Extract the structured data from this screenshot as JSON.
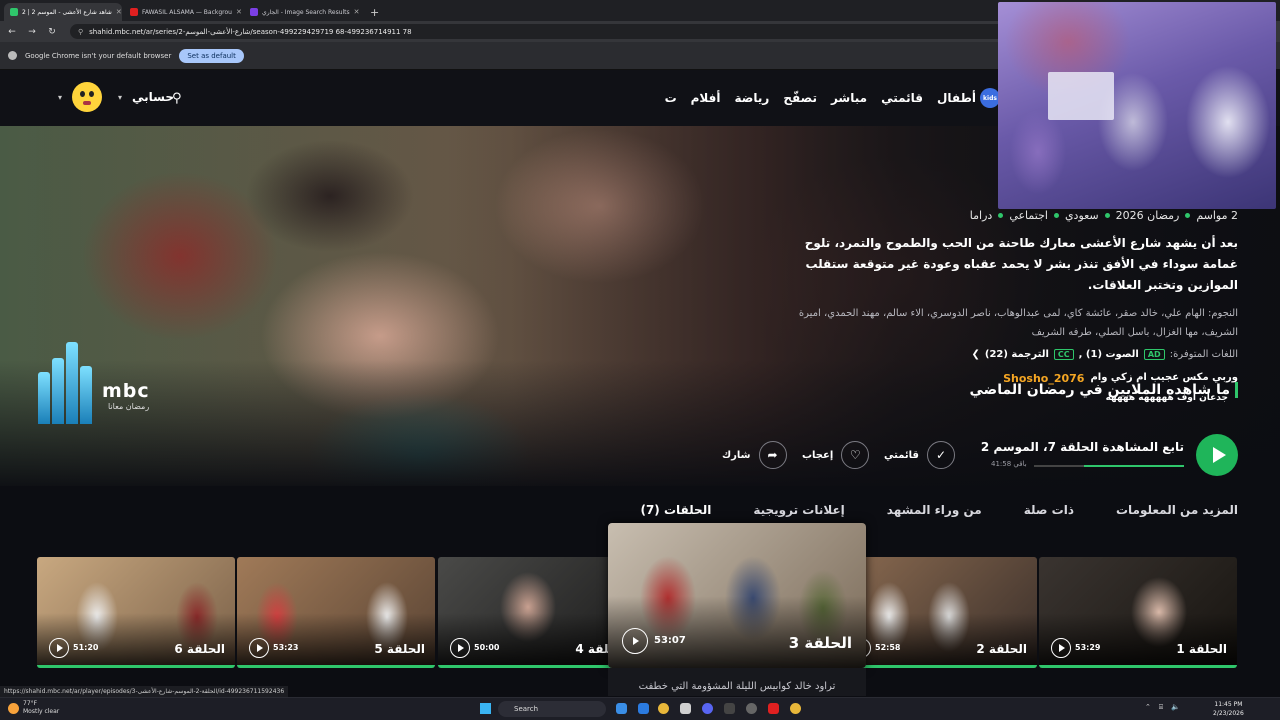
{
  "browser": {
    "tabs": [
      {
        "title": "شاهد شارع الأعشى - الموسم 2 | 2",
        "color": "#2fc66b",
        "active": true
      },
      {
        "title": "FAWASIL ALSAMA — Backgrou",
        "color": "#e02020",
        "active": false
      },
      {
        "title": "الجاري - Image Search Results",
        "color": "#7b3fe4",
        "active": false
      }
    ],
    "url": "shahid.mbc.net/ar/series/2-شارع-الأعشى-الموسم/season-499229429719 68-499236714911 78",
    "infobar_text": "Google Chrome isn't your default browser",
    "set_default_label": "Set as default"
  },
  "nav": {
    "links": [
      "ت",
      "أفلام",
      "رياضة",
      "تصفّح",
      "مباشر",
      "قائمتي",
      "أطفال"
    ],
    "kids_badge": "kids",
    "account_label": "حسابي"
  },
  "hero": {
    "meta": [
      "2 مواسم",
      "رمضان 2026",
      "سعودي",
      "اجتماعي",
      "دراما"
    ],
    "synopsis": "بعد أن يشهد شارع الأعشى معارك طاحنة من الحب والطموح والتمرد، تلوح غمامة سوداء في الأفق تنذر بشر لا يحمد عقباه وعودة غير متوقعة ستقلب الموازين وتختبر العلاقات.",
    "cast": "النجوم: الهام علي، خالد صقر، عائشة كاي، لمى عبدالوهاب، ناصر الدوسري، الاء سالم، مهند الحمدي، اميرة الشريف، مها الغزال، باسل الصلي، طرفه الشريف",
    "languages_label": "اللغات المتوفرة:",
    "audio_tag": "AD",
    "audio_label": "الصوت (1) ,",
    "subs_tag": "CC",
    "subs_label": "الترجمة (22)",
    "chat_prefix": "وربي مكس عجيب ام زكي وام",
    "chat_user": "Shosho_2076",
    "chat_line2": "ما شاهده الملايين في رمضان الماضي",
    "chat_line3": "جدعان اوف هههههه ههههه",
    "logo_text": "mbc",
    "logo_sub": "رمضان معانا"
  },
  "actions": {
    "continue_label": "تابع المشاهدة الحلقة 7، الموسم 2",
    "remaining": "41:58 باقي",
    "progress_pct": 67,
    "mylist_label": "قائمتي",
    "like_label": "إعجاب",
    "share_label": "شارك"
  },
  "tabs": [
    "الحلقات (7)",
    "إعلانات ترويجية",
    "من وراء المشهد",
    "ذات صلة",
    "المزيد من المعلومات"
  ],
  "episodes": [
    {
      "title": "الحلقة 1",
      "duration": "53:29"
    },
    {
      "title": "الحلقة 2",
      "duration": "52:58"
    },
    {
      "title": "الحلقة 3",
      "duration": "53:07",
      "description": "تراود خالد كوابيس الليلة المشؤومة التي خطفت"
    },
    {
      "title": "الحلقة 4",
      "duration": "50:00"
    },
    {
      "title": "الحلقة 5",
      "duration": "53:23"
    },
    {
      "title": "الحلقة 6",
      "duration": "51:20"
    }
  ],
  "status_link": "https://shahid.mbc.net/ar/player/episodes/3-الحلقة-2-الموسم-شارع-الأعشى/id-499236711592436",
  "taskbar": {
    "weather_temp": "77°F",
    "weather_desc": "Mostly clear",
    "search_label": "Search",
    "time": "11:45 PM",
    "date": "2/23/2026"
  }
}
